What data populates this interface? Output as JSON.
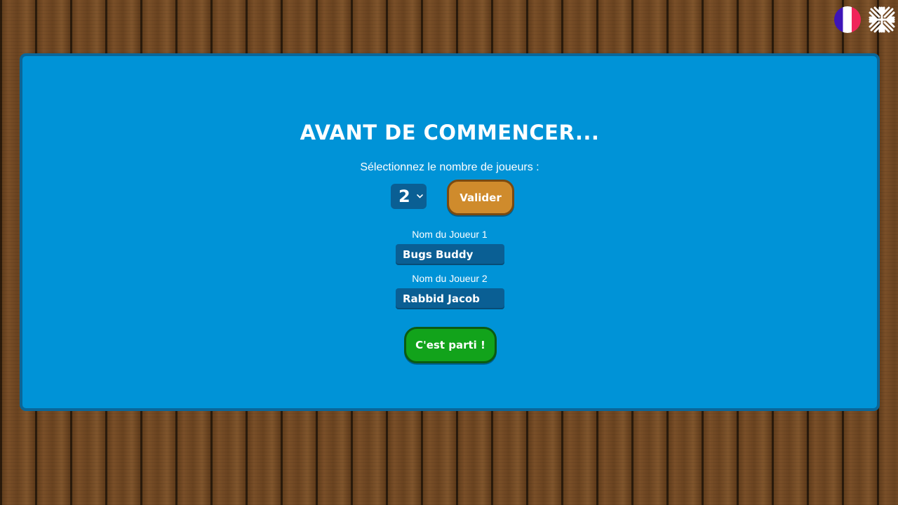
{
  "language_bar": {
    "french_flag_icon": "flag-fr-icon",
    "english_flag_icon": "flag-uk-icon"
  },
  "setup": {
    "title": "AVANT DE COMMENCER...",
    "player_count_prompt": "Sélectionnez le nombre de joueurs :",
    "player_count_selected": "2",
    "validate_label": "Valider",
    "players": [
      {
        "label": "Nom du Joueur 1",
        "name": "Bugs Buddy"
      },
      {
        "label": "Nom du Joueur 2",
        "name": "Rabbid Jacob"
      }
    ],
    "start_label": "C'est parti !"
  },
  "colors": {
    "panel": "#0093d7",
    "panel_border": "#0a6699",
    "validate_button": "#cf8b2c",
    "start_button": "#12a31b",
    "field_background": "#0a5f94"
  }
}
